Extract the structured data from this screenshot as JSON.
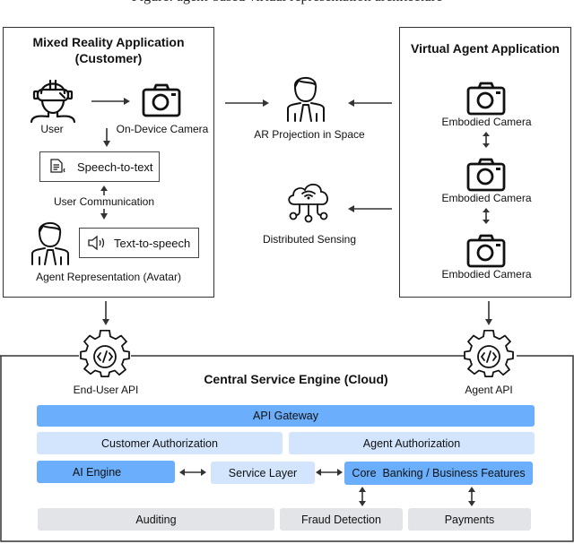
{
  "caption_fragment": "Figure: agent-based virtual representation architecture",
  "customer_app": {
    "title_line1": "Mixed Reality Application",
    "title_line2": "(Customer)",
    "user_label": "User",
    "camera_label": "On-Device Camera",
    "speech_to_text": "Speech-to-text",
    "user_communication": "User Communication",
    "text_to_speech": "Text-to-speech",
    "agent_representation": "Agent Representation (Avatar)"
  },
  "middle": {
    "ar_projection": "AR Projection in Space",
    "distributed_sensing": "Distributed Sensing"
  },
  "agent_app": {
    "title": "Virtual Agent Application",
    "cameras": [
      "Embodied Camera",
      "Embodied Camera",
      "Embodied Camera"
    ]
  },
  "engine": {
    "title": "Central Service Engine (Cloud)",
    "end_user_api": "End-User API",
    "agent_api": "Agent API",
    "api_gateway": "API Gateway",
    "customer_authorization": "Customer Authorization",
    "agent_authorization": "Agent Authorization",
    "ai_engine": "AI Engine",
    "service_layer": "Service Layer",
    "core_banking": "Core  Banking / Business Features",
    "auditing": "Auditing",
    "fraud_detection": "Fraud Detection",
    "payments": "Payments"
  },
  "colors": {
    "primary_block": "#6aaefc",
    "secondary_block": "#d3e5fc",
    "support_block": "#e2e4e8"
  }
}
